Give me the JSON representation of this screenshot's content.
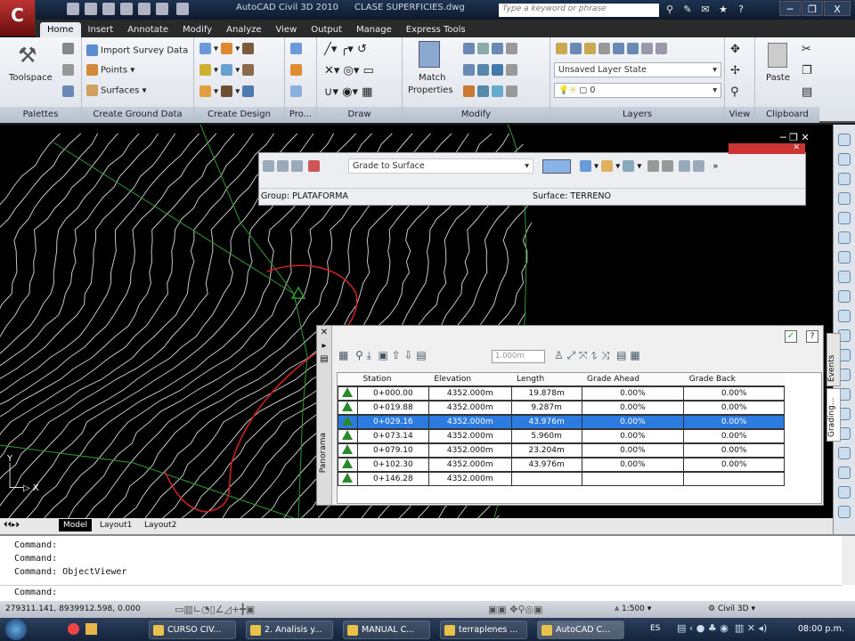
{
  "titlebar": {
    "app_title": "AutoCAD Civil 3D 2010",
    "doc_title": "CLASE SUPERFICIES.dwg",
    "search_placeholder": "Type a keyword or phrase",
    "min": "─",
    "max": "❐",
    "close": "X"
  },
  "tabs": [
    "Home",
    "Insert",
    "Annotate",
    "Modify",
    "Analyze",
    "View",
    "Output",
    "Manage",
    "Express Tools"
  ],
  "ribbon": {
    "palettes": {
      "toolspace": "Toolspace",
      "label": "Palettes"
    },
    "ground": {
      "items": [
        "Import Survey Data",
        "Points",
        "Surfaces"
      ],
      "label": "Create Ground Data"
    },
    "design": {
      "label": "Create Design"
    },
    "profile": {
      "label": "Pro..."
    },
    "draw": {
      "label": "Draw"
    },
    "modify": {
      "match": "Match",
      "properties": "Properties",
      "label": "Modify"
    },
    "layers": {
      "layer_state": "Unsaved Layer State",
      "layer": "0",
      "label": "Layers"
    },
    "view": {
      "label": "View"
    },
    "clipboard": {
      "paste": "Paste",
      "label": "Clipboard"
    }
  },
  "grading_toolbar": {
    "command": "Grade to Surface",
    "group": "Group: PLATAFORMA",
    "surface": "Surface: TERRENO"
  },
  "panorama": {
    "title": "Panorama",
    "side_tabs": [
      "Events",
      "Grading..."
    ],
    "step_value": "1.000m",
    "ok": "✓",
    "help": "?",
    "columns": [
      "Station",
      "Elevation",
      "Length",
      "Grade Ahead",
      "Grade Back"
    ],
    "rows": [
      {
        "station": "0+000.00",
        "elevation": "4352.000m",
        "length": "19.878m",
        "ahead": "0.00%",
        "back": "0.00%"
      },
      {
        "station": "0+019.88",
        "elevation": "4352.000m",
        "length": "9.287m",
        "ahead": "0.00%",
        "back": "0.00%"
      },
      {
        "station": "0+029.16",
        "elevation": "4352.000m",
        "length": "43.976m",
        "ahead": "0.00%",
        "back": "0.00%",
        "selected": true
      },
      {
        "station": "0+073.14",
        "elevation": "4352.000m",
        "length": "5.960m",
        "ahead": "0.00%",
        "back": "0.00%"
      },
      {
        "station": "0+079.10",
        "elevation": "4352.000m",
        "length": "23.204m",
        "ahead": "0.00%",
        "back": "0.00%"
      },
      {
        "station": "0+102.30",
        "elevation": "4352.000m",
        "length": "43.976m",
        "ahead": "0.00%",
        "back": "0.00%"
      },
      {
        "station": "0+146.28",
        "elevation": "4352.000m",
        "length": "",
        "ahead": "",
        "back": ""
      }
    ]
  },
  "layout_tabs": [
    "Model",
    "Layout1",
    "Layout2"
  ],
  "command_lines": [
    "Command:",
    "Command:",
    "Command: ObjectViewer"
  ],
  "command_prompt": "Command:",
  "status": {
    "coords": "279311.141, 8939912.598, 0.000",
    "scale": "1:500",
    "workspace": "Civil 3D"
  },
  "taskbar": {
    "items": [
      "CURSO CIV...",
      "2. Analisis y...",
      "MANUAL C...",
      "terraplenes ...",
      "AutoCAD C..."
    ],
    "lang": "ES",
    "clock": "08:00 p.m."
  },
  "colors": {
    "contour": "#e8e8e8",
    "boundary": "#2f9a2f",
    "grading": "#d42020",
    "selection": "#2b7be0"
  }
}
